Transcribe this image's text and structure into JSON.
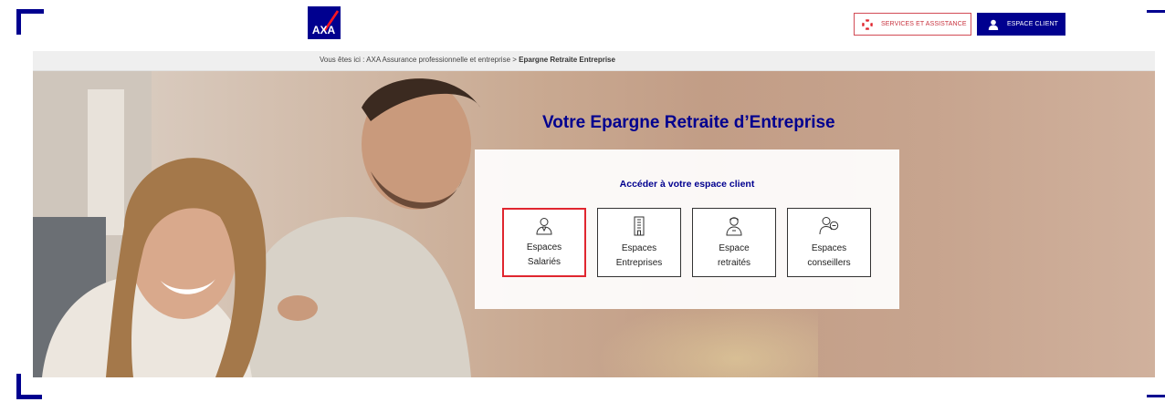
{
  "header": {
    "logo_text": "AXA",
    "services_label": "SERVICES ET ASSISTANCE",
    "client_label": "ESPACE CLIENT",
    "colors": {
      "brand": "#00008f",
      "accent_red": "#e0262f"
    }
  },
  "breadcrumb": {
    "prefix": "Vous êtes ici : ",
    "parent": "AXA Assurance professionnelle et entreprise",
    "separator": " > ",
    "current": "Epargne Retraite Entreprise"
  },
  "hero": {
    "title": "Votre Epargne Retraite d’Entreprise",
    "card_title": "Accéder à votre espace client",
    "tiles": [
      {
        "line1": "Espaces",
        "line2": "Salariés",
        "icon": "employee-icon",
        "selected": true
      },
      {
        "line1": "Espaces",
        "line2": "Entreprises",
        "icon": "building-icon",
        "selected": false
      },
      {
        "line1": "Espace",
        "line2": "retraités",
        "icon": "retiree-icon",
        "selected": false
      },
      {
        "line1": "Espaces",
        "line2": "conseillers",
        "icon": "advisor-icon",
        "selected": false
      }
    ]
  }
}
